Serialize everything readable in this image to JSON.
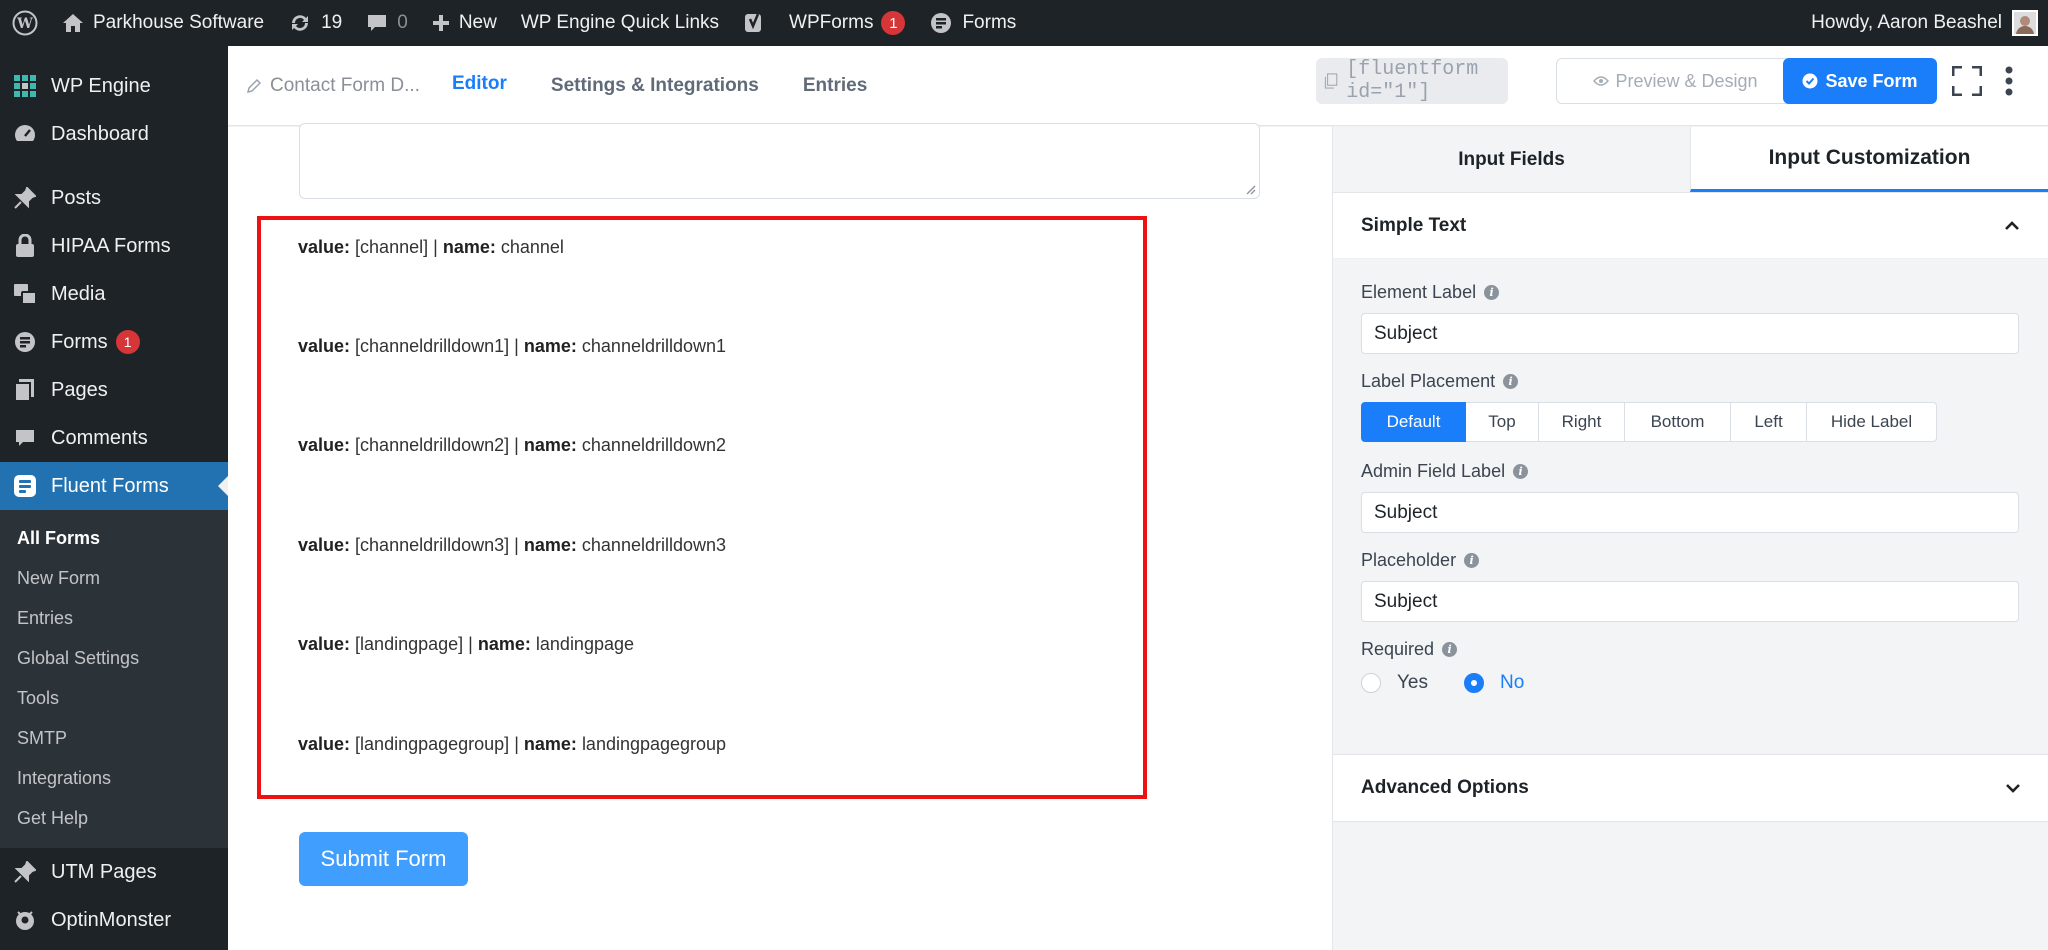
{
  "adminbar": {
    "site_name": "Parkhouse Software",
    "updates_count": "19",
    "comments_count": "0",
    "new_label": "New",
    "quick_links_label": "WP Engine Quick Links",
    "wpforms_label": "WPForms",
    "wpforms_badge": "1",
    "forms_label": "Forms",
    "greeting": "Howdy, Aaron Beashel"
  },
  "sidebar": {
    "items": [
      {
        "label": "WP Engine",
        "icon": "wp-engine-icon"
      },
      {
        "label": "Dashboard",
        "icon": "dashboard-icon"
      },
      {
        "label": "Posts",
        "icon": "pin-icon"
      },
      {
        "label": "HIPAA Forms",
        "icon": "lock-icon"
      },
      {
        "label": "Media",
        "icon": "media-icon"
      },
      {
        "label": "Forms",
        "icon": "forms-icon",
        "badge": "1"
      },
      {
        "label": "Pages",
        "icon": "pages-icon"
      },
      {
        "label": "Comments",
        "icon": "comments-icon"
      },
      {
        "label": "Fluent Forms",
        "icon": "fluent-forms-icon"
      }
    ],
    "submenu": [
      "All Forms",
      "New Form",
      "Entries",
      "Global Settings",
      "Tools",
      "SMTP",
      "Integrations",
      "Get Help"
    ],
    "bottom_items": [
      {
        "label": "UTM Pages",
        "icon": "pin-icon"
      },
      {
        "label": "OptinMonster",
        "icon": "optinmonster-icon"
      }
    ]
  },
  "tabbar": {
    "form_title": "Contact Form D...",
    "tabs": [
      "Editor",
      "Settings & Integrations",
      "Entries"
    ],
    "shortcode": "[fluentform id=\"1\"]",
    "preview_label": "Preview & Design",
    "save_label": "Save Form"
  },
  "editor": {
    "key_label": "value:",
    "name_label": "name:",
    "separator": "|",
    "fields": [
      {
        "value": "[channel]",
        "name": "channel"
      },
      {
        "value": "[channeldrilldown1]",
        "name": "channeldrilldown1"
      },
      {
        "value": "[channeldrilldown2]",
        "name": "channeldrilldown2"
      },
      {
        "value": "[channeldrilldown3]",
        "name": "channeldrilldown3"
      },
      {
        "value": "[landingpage]",
        "name": "landingpage"
      },
      {
        "value": "[landingpagegroup]",
        "name": "landingpagegroup"
      }
    ],
    "submit_label": "Submit Form"
  },
  "panel": {
    "tabs": [
      "Input Fields",
      "Input Customization"
    ],
    "section_title": "Simple Text",
    "element_label": {
      "label": "Element Label",
      "value": "Subject"
    },
    "label_placement": {
      "label": "Label Placement",
      "options": [
        "Default",
        "Top",
        "Right",
        "Bottom",
        "Left",
        "Hide Label"
      ],
      "selected": "Default"
    },
    "admin_field_label": {
      "label": "Admin Field Label",
      "value": "Subject"
    },
    "placeholder": {
      "label": "Placeholder",
      "value": "Subject"
    },
    "required": {
      "label": "Required",
      "options": [
        "Yes",
        "No"
      ],
      "selected": "No"
    },
    "advanced_title": "Advanced Options",
    "info_glyph": "i"
  },
  "colors": {
    "accent": "#1a7efb",
    "admin_dark": "#1d2327",
    "highlight_border": "#ee1111",
    "submit": "#409eff"
  }
}
